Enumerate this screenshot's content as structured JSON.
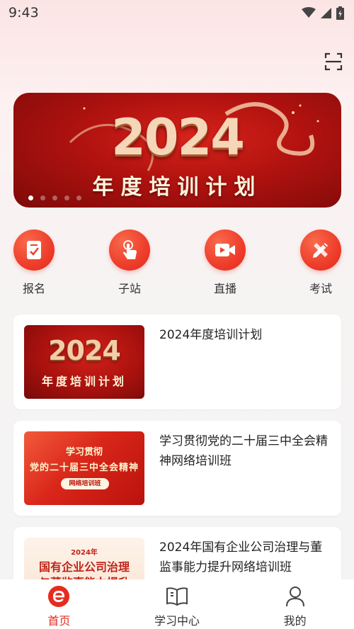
{
  "status_bar": {
    "time": "9:43"
  },
  "banner": {
    "year": "2024",
    "title": "年度培训计划",
    "dot_count": 5,
    "active_dot": 0
  },
  "quick_actions": [
    {
      "label": "报名",
      "icon": "signup-form-icon"
    },
    {
      "label": "子站",
      "icon": "tap-hand-icon"
    },
    {
      "label": "直播",
      "icon": "video-camera-icon"
    },
    {
      "label": "考试",
      "icon": "pencil-ruler-icon"
    }
  ],
  "courses": [
    {
      "title": "2024年度培训计划",
      "thumb": {
        "year": "2024",
        "sub": "年度培训计划"
      }
    },
    {
      "title": "学习贯彻党的二十届三中全会精神网络培训班",
      "thumb": {
        "line1": "学习贯彻",
        "line2": "党的二十届三中全会精神",
        "tag": "网络培训班"
      }
    },
    {
      "title": "2024年国有企业公司治理与董监事能力提升网络培训班",
      "thumb": {
        "year": "2024年",
        "line1": "国有企业公司治理",
        "line2": "与董监事能力提升"
      }
    }
  ],
  "bottom_nav": [
    {
      "label": "首页",
      "active": true
    },
    {
      "label": "学习中心",
      "active": false
    },
    {
      "label": "我的",
      "active": false
    }
  ],
  "colors": {
    "accent": "#e52c1f",
    "banner": "#b0120f"
  }
}
